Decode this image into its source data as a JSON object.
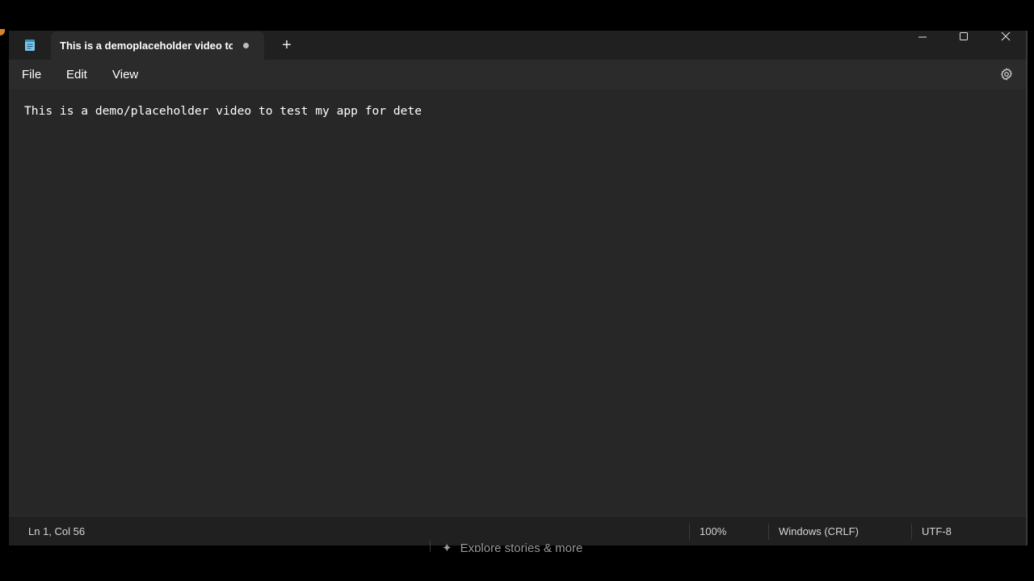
{
  "window": {
    "tab_title": "This is a demoplaceholder video to",
    "new_tab_glyph": "+"
  },
  "menu": {
    "file": "File",
    "edit": "Edit",
    "view": "View"
  },
  "editor": {
    "content": "This is a demo/placeholder video to test my app for dete"
  },
  "status": {
    "position": "Ln 1, Col 56",
    "zoom": "100%",
    "line_ending": "Windows (CRLF)",
    "encoding": "UTF-8"
  },
  "taskbar": {
    "partial_text": "Explore stories & more"
  },
  "icons": {
    "app": "notepad-icon",
    "unsaved": "unsaved-dot-icon",
    "minimize": "minimize-icon",
    "maximize": "maximize-icon",
    "close": "close-icon",
    "settings": "gear-icon"
  },
  "colors": {
    "titlebar": "#202020",
    "menubar": "#2b2b2b",
    "editor": "#272727",
    "statusbar": "#202020",
    "text": "#ffffff",
    "app_icon": "#7cc7e8"
  }
}
